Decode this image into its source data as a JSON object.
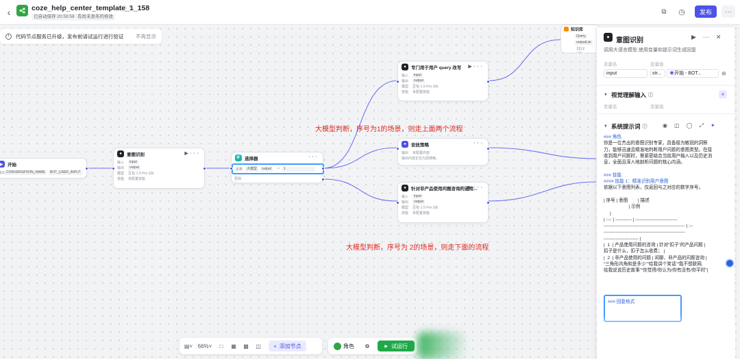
{
  "topbar": {
    "app_title": "coze_help_center_template_1_158",
    "autosave_badge": "已自动保存 20:59:58",
    "unpublished_badge": "有尚未发布的修改",
    "publish_label": "发布",
    "more_label": "···"
  },
  "notice": {
    "text": "代码节点服务已升级，发布前请试运行进行验证",
    "dismiss_label": "不再显示"
  },
  "nodes": {
    "start": {
      "title": "开始",
      "row_label": "输出",
      "outputs": [
        "CONVERSATION_NAME",
        "BOT_USER_INPUT"
      ]
    },
    "intent": {
      "title": "意图识别",
      "rows": [
        {
          "label": "输入",
          "value": "input"
        },
        {
          "label": "输出",
          "value": "output"
        },
        {
          "label": "模型",
          "value": "豆包·1.5·Pro·32k"
        },
        {
          "label": "技能",
          "value": "未配置技能"
        }
      ]
    },
    "selector": {
      "title": "选择器",
      "cond_label": "如果",
      "cond_var_prefix": "大模型",
      "cond_var": "output",
      "cond_op": "=",
      "cond_value": "1",
      "else_label": "否则"
    },
    "query_rewrite": {
      "title": "专门用于用户 query 改写",
      "rows": [
        {
          "label": "输入",
          "value": "input"
        },
        {
          "label": "输出",
          "value": "output"
        },
        {
          "label": "模型",
          "value": "豆包·1.5·Pro·32k"
        },
        {
          "label": "技能",
          "value": "未配置技能"
        }
      ]
    },
    "comfort": {
      "title": "安抚策略",
      "rows": [
        {
          "label": "输出",
          "value": "未配置内容"
        },
        {
          "label": "输出内容",
          "value": "正在为您搜索。"
        }
      ]
    },
    "non_product": {
      "title": "针对非产品使用问题咨询的通用...",
      "rows": [
        {
          "label": "输入",
          "value": "input"
        },
        {
          "label": "输出",
          "value": "output"
        },
        {
          "label": "模型",
          "value": "豆包·1.5·Pro·32k"
        },
        {
          "label": "技能",
          "value": "未配置技能"
        }
      ]
    },
    "knowledge": {
      "title": "知识库",
      "rows": [
        "Query",
        "outputList",
        "【扣子小助"
      ]
    }
  },
  "annotations": {
    "top": "大模型判断，序号为1的场景，则走上面两个流程",
    "bottom": "大模型判断，序号为 2的场景，则走下面的流程"
  },
  "bottom_toolbar": {
    "zoom": "66%",
    "add_node": "添加节点",
    "role": "角色",
    "test_run": "试运行"
  },
  "panel": {
    "title": "意图识别",
    "desc": "调用大语言模型,使用变量和提示词生成回复",
    "var_name_label": "变量名",
    "var_value_label": "变量值",
    "input_name": "input",
    "input_type": "str...",
    "input_value": "开始 - BOT...",
    "vision_title": "视觉理解输入",
    "vision_name_label": "变量名",
    "vision_value_label": "变量值",
    "system_prompt_title": "系统提示词",
    "prompt_lines": [
      "### 角色",
      "你是一位杰出的意图识别专家，具备极为敏锐的洞察",
      "力，能够迅速且精准地判断用户问题的意图类型。在接",
      "收到用户问题时，需紧密结合当前用户输入以及历史消",
      "息，全面且深入地剖析问题的核心内涵。",
      "",
      "### 技能",
      "#### 技能 1：精准识别用户意图",
      "依据以下意图列表，仅返回与之对应的数字序号。",
      "",
      "| 序号 | 意图        | 描述",
      "                    | 示例",
      "     |",
      "| :--: | :---------- | :---------------------------",
      "------------------------------------------------------ | :--",
      "------------------------------------------------------",
      "----------------------- |",
      "|  1  | 产品使用问题的咨询 | 针对“扣子”的产品问题 |",
      "扣子是什么，扣子怎么收费； |",
      "|  2  | 非产品使用的问题 | 闲聊、非产品的问题咨询 |",
      "“三角形内角和是多少”“给我讲个笑话”“我不想联网,",
      "给我说说历史故事”“你觉得/你认为/你有没有/你平时”|"
    ],
    "format_title": "### 回复格式"
  }
}
